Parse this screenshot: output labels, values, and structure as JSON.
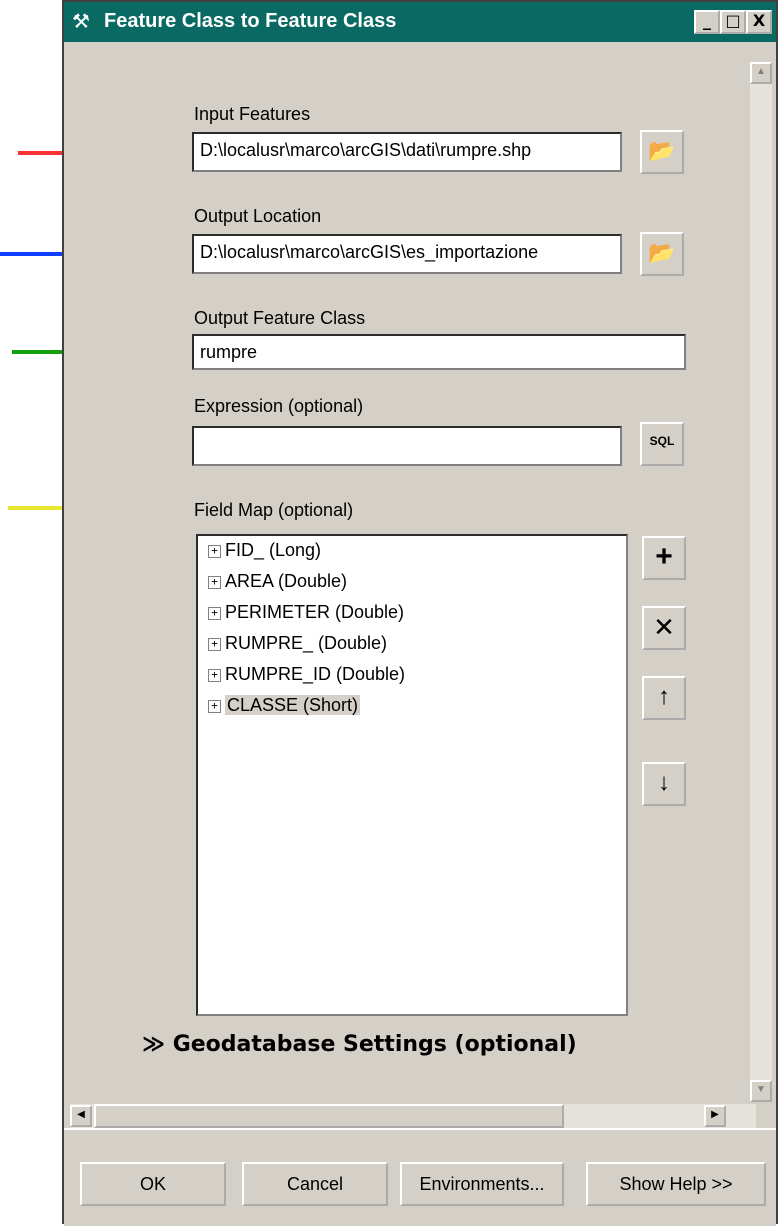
{
  "window": {
    "title": "Feature Class to Feature Class",
    "min": "_",
    "max": "□",
    "close": "X"
  },
  "annotations": {
    "colors": [
      "#ff3333",
      "#1040ff",
      "#10a010",
      "#e8e830"
    ]
  },
  "fields": {
    "input_features": {
      "label": "Input Features",
      "value": "D:\\localusr\\marco\\arcGIS\\dati\\rumpre.shp"
    },
    "output_location": {
      "label": "Output Location",
      "value": "D:\\localusr\\marco\\arcGIS\\es_importazione"
    },
    "output_feature_class": {
      "label": "Output Feature Class",
      "value": "rumpre"
    },
    "expression": {
      "label": "Expression (optional)",
      "value": ""
    },
    "field_map": {
      "label": "Field Map (optional)",
      "items": [
        "FID_ (Long)",
        "AREA (Double)",
        "PERIMETER (Double)",
        "RUMPRE_ (Double)",
        "RUMPRE_ID (Double)",
        "CLASSE (Short)"
      ],
      "selected": "CLASSE (Short)"
    }
  },
  "geodatabase_settings": "Geodatabase Settings (optional)",
  "buttons": {
    "ok": "OK",
    "cancel": "Cancel",
    "environments": "Environments...",
    "show_help": "Show Help >>"
  }
}
